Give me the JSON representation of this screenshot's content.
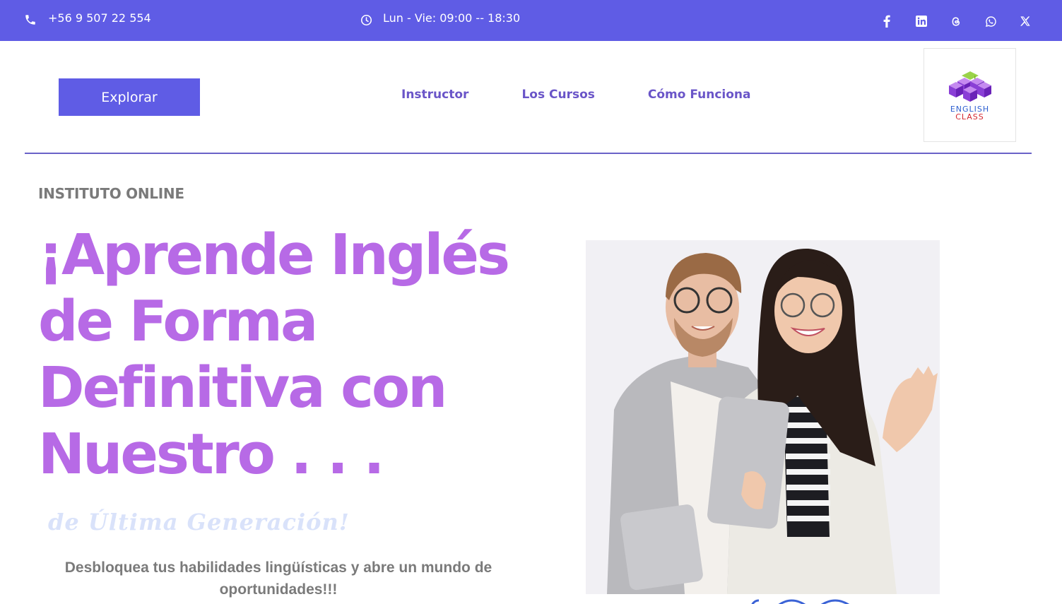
{
  "topbar": {
    "phone": "+56 9 507 22 554",
    "hours": "Lun - Vie: 09:00 -- 18:30",
    "social": [
      "facebook-icon",
      "linkedin-icon",
      "threads-icon",
      "whatsapp-icon",
      "x-icon"
    ],
    "background": "#5f5ce5"
  },
  "header": {
    "explore_label": "Explorar",
    "nav": [
      {
        "label": "Instructor"
      },
      {
        "label": "Los Cursos"
      },
      {
        "label": "Cómo Funciona"
      }
    ],
    "logo": {
      "line1": "ENGLISH",
      "line2": "CLASS"
    }
  },
  "hero": {
    "eyebrow": "INSTITUTO ONLINE",
    "title": "¡Aprende Inglés de Forma Definitiva con Nuestro . . .",
    "subtitle": "de Última Generación!",
    "description": "Desbloquea tus habilidades lingüísticas y abre un mundo de oportunidades!!!",
    "title_color": "#b76ae6"
  }
}
